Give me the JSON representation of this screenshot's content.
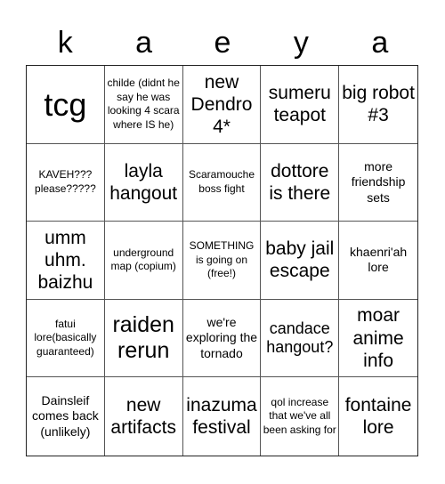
{
  "title_letters": [
    "k",
    "a",
    "e",
    "y",
    "a"
  ],
  "cells": [
    "tcg",
    "childe (didnt he say he was looking 4 scara where IS he)",
    "new Dendro 4*",
    "sumeru teapot",
    "big robot #3",
    "KAVEH??? please?????",
    "layla hangout",
    "Scaramouche boss fight",
    "dottore is there",
    "more friendship sets",
    "umm uhm. baizhu",
    "underground map (copium)",
    "SOMETHING is going on (free!)",
    "baby jail escape",
    "khaenri'ah lore",
    "fatui lore(basically guaranteed)",
    "raiden rerun",
    "we're exploring the tornado",
    "candace hangout?",
    "moar anime info",
    "Dainsleif comes back (unlikely)",
    "new artifacts",
    "inazuma festival",
    "qol increase that we've all been asking for",
    "fontaine lore"
  ]
}
